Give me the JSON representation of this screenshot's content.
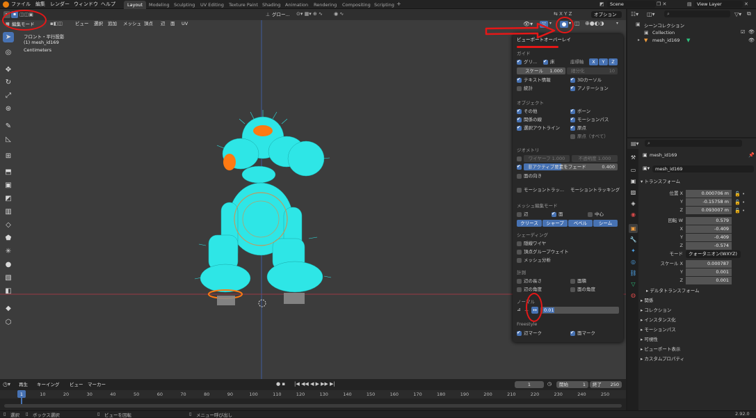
{
  "menu": [
    "ファイル",
    "編集",
    "レンダー",
    "ウィンドウ",
    "ヘルプ"
  ],
  "workspaces": [
    {
      "label": "Layout",
      "active": true
    },
    {
      "label": "Modeling"
    },
    {
      "label": "Sculpting"
    },
    {
      "label": "UV Editing"
    },
    {
      "label": "Texture Paint"
    },
    {
      "label": "Shading"
    },
    {
      "label": "Animation"
    },
    {
      "label": "Rendering"
    },
    {
      "label": "Compositing"
    },
    {
      "label": "Scripting"
    }
  ],
  "scene": {
    "name": "Scene",
    "view_layer": "View Layer"
  },
  "viewport": {
    "mode": "編集モード",
    "menus": [
      "ビュー",
      "選択",
      "追加",
      "メッシュ",
      "頂点",
      "辺",
      "面",
      "UV"
    ],
    "transform_orientation": "グロー...",
    "options_label": "オプション",
    "view_name": "フロント・平行投影",
    "object_label": "(1) mesh_id169",
    "units": "Centimeters",
    "gizmo_axes": [
      "X",
      "Y",
      "Z"
    ]
  },
  "overlay": {
    "title": "ビューポートオーバーレイ",
    "guides": "ガイド",
    "grid": "グリ...",
    "floor": "床",
    "axes_label": "座標軸",
    "axes": [
      "X",
      "Y",
      "Z"
    ],
    "scale_label": "スケール",
    "scale_value": "1.000",
    "subdiv_label": "細分化",
    "subdiv_value": "10",
    "text_info": "テキスト情報",
    "cursor3d": "3Dカーソル",
    "stats": "統計",
    "annotations": "アノテーション",
    "objects": "オブジェクト",
    "extras": "その他",
    "bones": "ボーン",
    "relations": "関係の線",
    "motion_paths": "モーションパス",
    "outline": "選択アウトライン",
    "origins": "原点",
    "origins_all": "原点（すべて）",
    "geometry": "ジオメトリ",
    "wireframe": "ワイヤーフ  1.000",
    "opacity": "不透明度  1.000",
    "fade": "非アクティブ要素をフェード",
    "fade_value": "0.400",
    "face_orientation": "面の向き",
    "motion_tracking": "モーショントラッ...",
    "motion_tracking2": "モーショントラッキング",
    "mesh_edit": "メッシュ編集モード",
    "edge": "辺",
    "face": "面",
    "center": "中心",
    "edge_marks": [
      "クリース",
      "シャープ",
      "ベベル",
      "シーム"
    ],
    "shading": "シェーディング",
    "hidden_wire": "隠線ワイヤ",
    "vgroup_weights": "頂点グループウェイト",
    "mesh_analysis": "メッシュ分析",
    "measure": "計測",
    "edge_length": "辺の長さ",
    "face_area": "面積",
    "edge_angle": "辺の角度",
    "face_angle": "面の角度",
    "normals": "ノーマル",
    "normal_size": "0.01",
    "freestyle": "Freestyle",
    "edge_mark": "辺マーク",
    "face_mark": "面マーク"
  },
  "outliner": {
    "collection_root": "シーンコレクション",
    "collection": "Collection",
    "object": "mesh_id169"
  },
  "properties": {
    "object_name": "mesh_id169",
    "data_name": "mesh_id169",
    "transform": "トランスフォーム",
    "location_label": "位置 X",
    "loc": [
      "0.000706 m",
      "-0.15758 m",
      "0.093007 m"
    ],
    "rotation_label": "回転 W",
    "rot": [
      "0.579",
      "-0.409",
      "-0.409",
      "-0.574"
    ],
    "mode_label": "モード",
    "mode_value": "クォータニオン(WXYZ)",
    "scale_label": "スケール X",
    "scale": [
      "0.000787",
      "0.001",
      "0.001"
    ],
    "axis_y": "Y",
    "axis_z": "Z",
    "axis_x": "X",
    "sections": [
      "デルタトランスフォーム",
      "関係",
      "コレクション",
      "インスタンス化",
      "モーションパス",
      "可視性",
      "ビューポート表示",
      "カスタムプロパティ"
    ]
  },
  "timeline": {
    "menus": [
      "再生",
      "キーイング",
      "ビュー",
      "マーカー"
    ],
    "current_frame": "1",
    "start_label": "開始",
    "start": "1",
    "end_label": "終了",
    "end": "250",
    "ticks": [
      "1",
      "10",
      "20",
      "30",
      "40",
      "50",
      "60",
      "70",
      "80",
      "90",
      "100",
      "110",
      "120",
      "130",
      "140",
      "150",
      "160",
      "170",
      "180",
      "190",
      "200",
      "210",
      "220",
      "230",
      "240",
      "250"
    ]
  },
  "status": {
    "select": "選択",
    "box_select": "ボックス選択",
    "rotate_view": "ビューを回転",
    "call_menu": "メニュー呼び出し",
    "version": "2.92.0"
  },
  "colors": {
    "accent": "#4772b3",
    "annotation": "#e51717",
    "mesh_cyan": "#2ee6e6",
    "mesh_orange": "#ff7a12"
  }
}
